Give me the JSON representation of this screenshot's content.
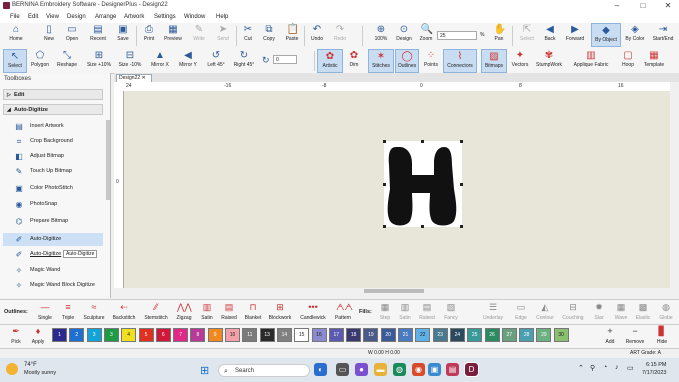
{
  "window": {
    "title": "BERNINA Embroidery Software - DesignerPlus - Design22",
    "controls": [
      "–",
      "□",
      "✕"
    ]
  },
  "menu": [
    "File",
    "Edit",
    "View",
    "Design",
    "Arrange",
    "Artwork",
    "Settings",
    "Window",
    "Help"
  ],
  "toolbar1": {
    "buttons": [
      {
        "label": "Home",
        "icon": "home-icon"
      },
      {
        "label": "New",
        "icon": "new-document-icon"
      },
      {
        "label": "Open",
        "icon": "open-folder-icon"
      },
      {
        "label": "Recent",
        "icon": "recent-icon"
      },
      {
        "label": "Save",
        "icon": "save-icon"
      },
      {
        "label": "Print",
        "icon": "print-icon"
      },
      {
        "label": "Preview",
        "icon": "preview-icon"
      },
      {
        "label": "Write",
        "icon": "write-icon",
        "disabled": true
      },
      {
        "label": "Send",
        "icon": "send-icon",
        "disabled": true
      },
      {
        "label": "Cut",
        "icon": "cut-icon"
      },
      {
        "label": "Copy",
        "icon": "copy-icon"
      },
      {
        "label": "Paste",
        "icon": "paste-icon"
      },
      {
        "label": "Undo",
        "icon": "undo-icon"
      },
      {
        "label": "Redo",
        "icon": "redo-icon",
        "disabled": true
      },
      {
        "label": "100%",
        "icon": "zoom-100-icon"
      },
      {
        "label": "Design",
        "icon": "zoom-design-icon"
      },
      {
        "label": "Zoom",
        "icon": "zoom-icon"
      },
      {
        "label": "Pan",
        "icon": "pan-hand-icon"
      },
      {
        "label": "Select",
        "icon": "select-arrow-icon",
        "disabled": true
      },
      {
        "label": "Back",
        "icon": "back-arrow-icon"
      },
      {
        "label": "Forward",
        "icon": "forward-arrow-icon"
      },
      {
        "label": "By Object",
        "icon": "by-object-icon",
        "active": true
      },
      {
        "label": "By Color",
        "icon": "by-color-icon"
      },
      {
        "label": "Start/End",
        "icon": "start-end-icon"
      }
    ],
    "zoom_value": "25",
    "zoom_unit": "%"
  },
  "toolbar2": {
    "buttons": [
      {
        "label": "Select",
        "icon": "select-icon",
        "active": true
      },
      {
        "label": "Polygon",
        "icon": "polygon-icon"
      },
      {
        "label": "Reshape",
        "icon": "reshape-icon"
      },
      {
        "label": "Size +10%",
        "icon": "size-plus-icon"
      },
      {
        "label": "Size -10%",
        "icon": "size-minus-icon"
      },
      {
        "label": "Mirror X",
        "icon": "mirror-x-icon"
      },
      {
        "label": "Mirror Y",
        "icon": "mirror-y-icon"
      },
      {
        "label": "Left 45°",
        "icon": "rotate-left-icon"
      },
      {
        "label": "Right 45°",
        "icon": "rotate-right-icon"
      },
      {
        "label": "Artistic",
        "icon": "artistic-icon",
        "active": true
      },
      {
        "label": "Dim",
        "icon": "dim-icon"
      },
      {
        "label": "Stitches",
        "icon": "stitches-icon",
        "active": true
      },
      {
        "label": "Outlines",
        "icon": "outlines-icon",
        "active": true
      },
      {
        "label": "Points",
        "icon": "points-icon"
      },
      {
        "label": "Connectors",
        "icon": "connectors-icon",
        "active": true
      },
      {
        "label": "Bitmaps",
        "icon": "bitmaps-icon",
        "active": true
      },
      {
        "label": "Vectors",
        "icon": "vectors-icon"
      },
      {
        "label": "StumpWork",
        "icon": "stumpwork-icon"
      },
      {
        "label": "Applique Fabric",
        "icon": "applique-fabric-icon"
      },
      {
        "label": "Hoop",
        "icon": "hoop-icon"
      },
      {
        "label": "Template",
        "icon": "template-icon"
      }
    ],
    "angle_value": "0"
  },
  "toolbox": {
    "title": "Toolboxes",
    "sections": [
      {
        "label": "Edit",
        "expanded": false
      },
      {
        "label": "Auto-Digitize",
        "expanded": true
      }
    ],
    "items": [
      {
        "label": "Insert Artwork",
        "icon": "insert-artwork-icon"
      },
      {
        "label": "Crop Background",
        "icon": "crop-icon"
      },
      {
        "label": "Adjust Bitmap",
        "icon": "adjust-bitmap-icon"
      },
      {
        "label": "Touch Up Bitmap",
        "icon": "touch-up-icon"
      },
      {
        "label": "Color PhotoStitch",
        "icon": "color-photostitch-icon"
      },
      {
        "label": "PhotoSnap",
        "icon": "photosnap-icon"
      },
      {
        "label": "Prepare Bitmap",
        "icon": "prepare-bitmap-icon"
      },
      {
        "label": "Auto-Digitize",
        "icon": "auto-digitize-icon",
        "selected": true
      },
      {
        "label": "Auto-Digitize",
        "icon": "auto-digitize-icon",
        "tooltip": "Auto-Digitize"
      },
      {
        "label": "Magic Wand",
        "icon": "magic-wand-icon"
      },
      {
        "label": "Magic Wand Block Digitize",
        "icon": "magic-wand-block-icon"
      }
    ]
  },
  "document": {
    "tab": "Design22"
  },
  "rulers": {
    "h": [
      "24",
      "-16",
      "-8",
      "0",
      "8",
      "16"
    ],
    "v": [
      "0"
    ]
  },
  "stitchbar": {
    "outlines_label": "Outlines:",
    "outlines": [
      "Single",
      "Triple",
      "Sculpture",
      "Backstitch",
      "Stemstitch",
      "Zigzag",
      "Satin",
      "Raised",
      "Blanket",
      "Blockwork",
      "Candlewick",
      "Pattern"
    ],
    "fills_label": "Fills:",
    "fills": [
      "Step",
      "Satin",
      "Raised",
      "Fancy",
      "Underlay",
      "Edge",
      "Contour",
      "Couching",
      "Star",
      "Wave",
      "Elastic",
      "Globe"
    ]
  },
  "palette": {
    "pick_label": "Pick",
    "apply_label": "Apply",
    "swatches": [
      {
        "num": "1",
        "color": "#2a2a8c"
      },
      {
        "num": "2",
        "color": "#1e6fd0"
      },
      {
        "num": "3",
        "color": "#12a4d8"
      },
      {
        "num": "3",
        "color": "#1f9b45"
      },
      {
        "num": "4",
        "color": "#f0e020"
      },
      {
        "num": "5",
        "color": "#e03020"
      },
      {
        "num": "6",
        "color": "#d01838"
      },
      {
        "num": "7",
        "color": "#e02888"
      },
      {
        "num": "8",
        "color": "#b83a98"
      },
      {
        "num": "9",
        "color": "#f08a20"
      },
      {
        "num": "10",
        "color": "#f4a0a8"
      },
      {
        "num": "11",
        "color": "#7a7a7a"
      },
      {
        "num": "13",
        "color": "#2a2a2a"
      },
      {
        "num": "14",
        "color": "#808080"
      },
      {
        "num": "15",
        "color": "#ffffff"
      },
      {
        "num": "16",
        "color": "#8a8ad0"
      },
      {
        "num": "17",
        "color": "#5a5ab0"
      },
      {
        "num": "18",
        "color": "#3a3a70"
      },
      {
        "num": "19",
        "color": "#4a5a8a"
      },
      {
        "num": "20",
        "color": "#3a5a9a"
      },
      {
        "num": "21",
        "color": "#4a7ac0"
      },
      {
        "num": "22",
        "color": "#60b0e8"
      },
      {
        "num": "23",
        "color": "#4a7a90"
      },
      {
        "num": "24",
        "color": "#2a4a60"
      },
      {
        "num": "25",
        "color": "#3a9a9a"
      },
      {
        "num": "26",
        "color": "#2a8a60"
      },
      {
        "num": "27",
        "color": "#6aa080"
      },
      {
        "num": "28",
        "color": "#4aa0b0"
      },
      {
        "num": "29",
        "color": "#6ab080"
      },
      {
        "num": "30",
        "color": "#8ac070"
      }
    ],
    "add_label": "Add",
    "remove_label": "Remove",
    "hide_label": "Hide"
  },
  "status": {
    "coords": "W 0.00 H 0.00",
    "art_grade": "ART Grade: A"
  },
  "taskbar": {
    "weather_temp": "74°F",
    "weather_desc": "Mostly sunny",
    "search_placeholder": "Search",
    "time": "6:15 PM",
    "date": "7/17/2023"
  }
}
